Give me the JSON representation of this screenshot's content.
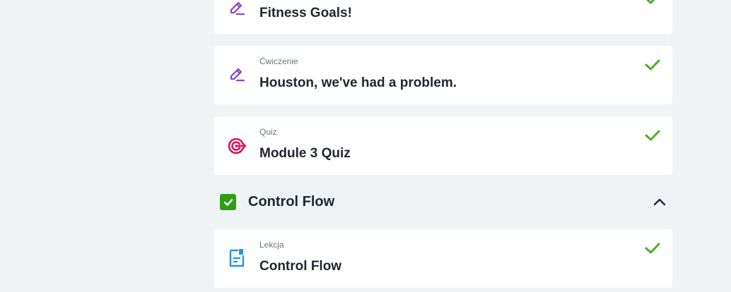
{
  "items_top": [
    {
      "type": "",
      "title": "Fitness Goals!",
      "icon": "pencil-icon",
      "completed": true
    },
    {
      "type": "Ćwiczenie",
      "title": "Houston, we've had a problem.",
      "icon": "pencil-icon",
      "completed": true
    },
    {
      "type": "Quiz",
      "title": "Module 3 Quiz",
      "icon": "target-icon",
      "completed": true
    }
  ],
  "section": {
    "title": "Control Flow",
    "completed": true,
    "expanded": true,
    "toggle_icon": "chevron-up-icon"
  },
  "items_section": [
    {
      "type": "Lekcja",
      "title": "Control Flow",
      "icon": "document-icon",
      "completed": true
    }
  ],
  "colors": {
    "background": "#f0f3f6",
    "card": "#ffffff",
    "check_green": "#4caf2a",
    "checkbox_green": "#2f9e14",
    "pencil_purple": "#8e44c9",
    "target_pink": "#e0105c",
    "document_blue": "#2196e3",
    "title_text": "#1f2630",
    "type_text": "#6a7380"
  }
}
